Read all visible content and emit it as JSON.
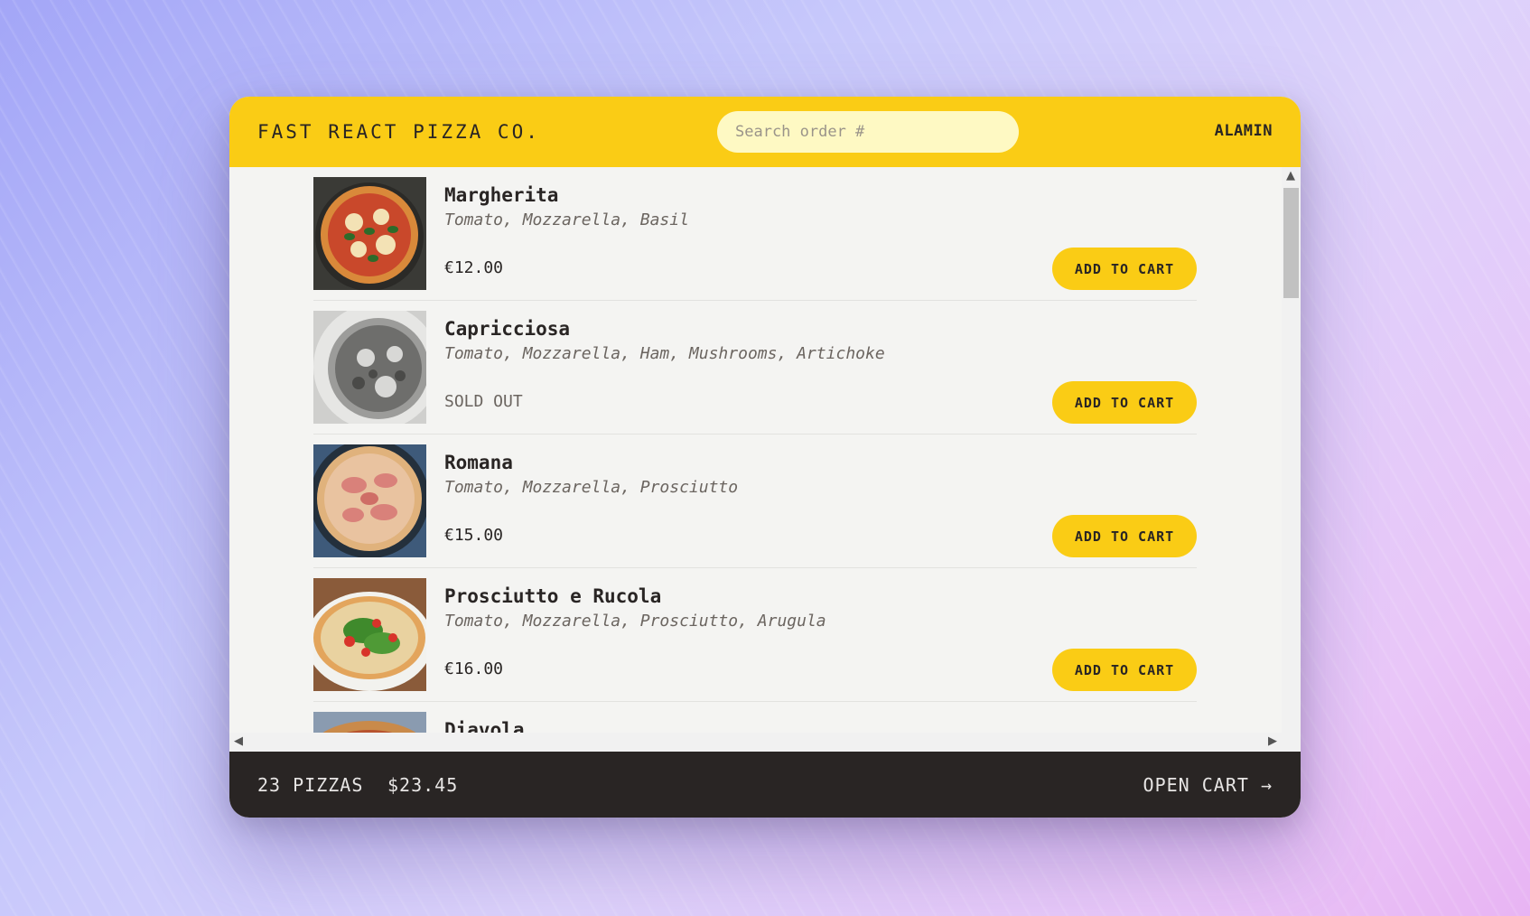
{
  "header": {
    "logo": "FAST REACT PIZZA CO.",
    "search_placeholder": "Search order #",
    "username": "ALAMIN"
  },
  "menu": [
    {
      "name": "Margherita",
      "ingredients": "Tomato, Mozzarella, Basil",
      "price": "€12.00",
      "sold_out": false,
      "button": "ADD TO CART",
      "image_icon": "pizza-margherita"
    },
    {
      "name": "Capricciosa",
      "ingredients": "Tomato, Mozzarella, Ham, Mushrooms, Artichoke",
      "price": "SOLD OUT",
      "sold_out": true,
      "button": "ADD TO CART",
      "image_icon": "pizza-capricciosa-grayscale"
    },
    {
      "name": "Romana",
      "ingredients": "Tomato, Mozzarella, Prosciutto",
      "price": "€15.00",
      "sold_out": false,
      "button": "ADD TO CART",
      "image_icon": "pizza-romana"
    },
    {
      "name": "Prosciutto e Rucola",
      "ingredients": "Tomato, Mozzarella, Prosciutto, Arugula",
      "price": "€16.00",
      "sold_out": false,
      "button": "ADD TO CART",
      "image_icon": "pizza-prosciutto-rucola"
    },
    {
      "name": "Diavola",
      "ingredients": "",
      "price": "",
      "sold_out": false,
      "button": "",
      "image_icon": "pizza-diavola"
    }
  ],
  "footer": {
    "count": "23 PIZZAS",
    "total": "$23.45",
    "open_cart": "OPEN CART →"
  },
  "colors": {
    "accent": "#facc15",
    "footer_bg": "#292524",
    "search_bg": "#fef9c3"
  }
}
